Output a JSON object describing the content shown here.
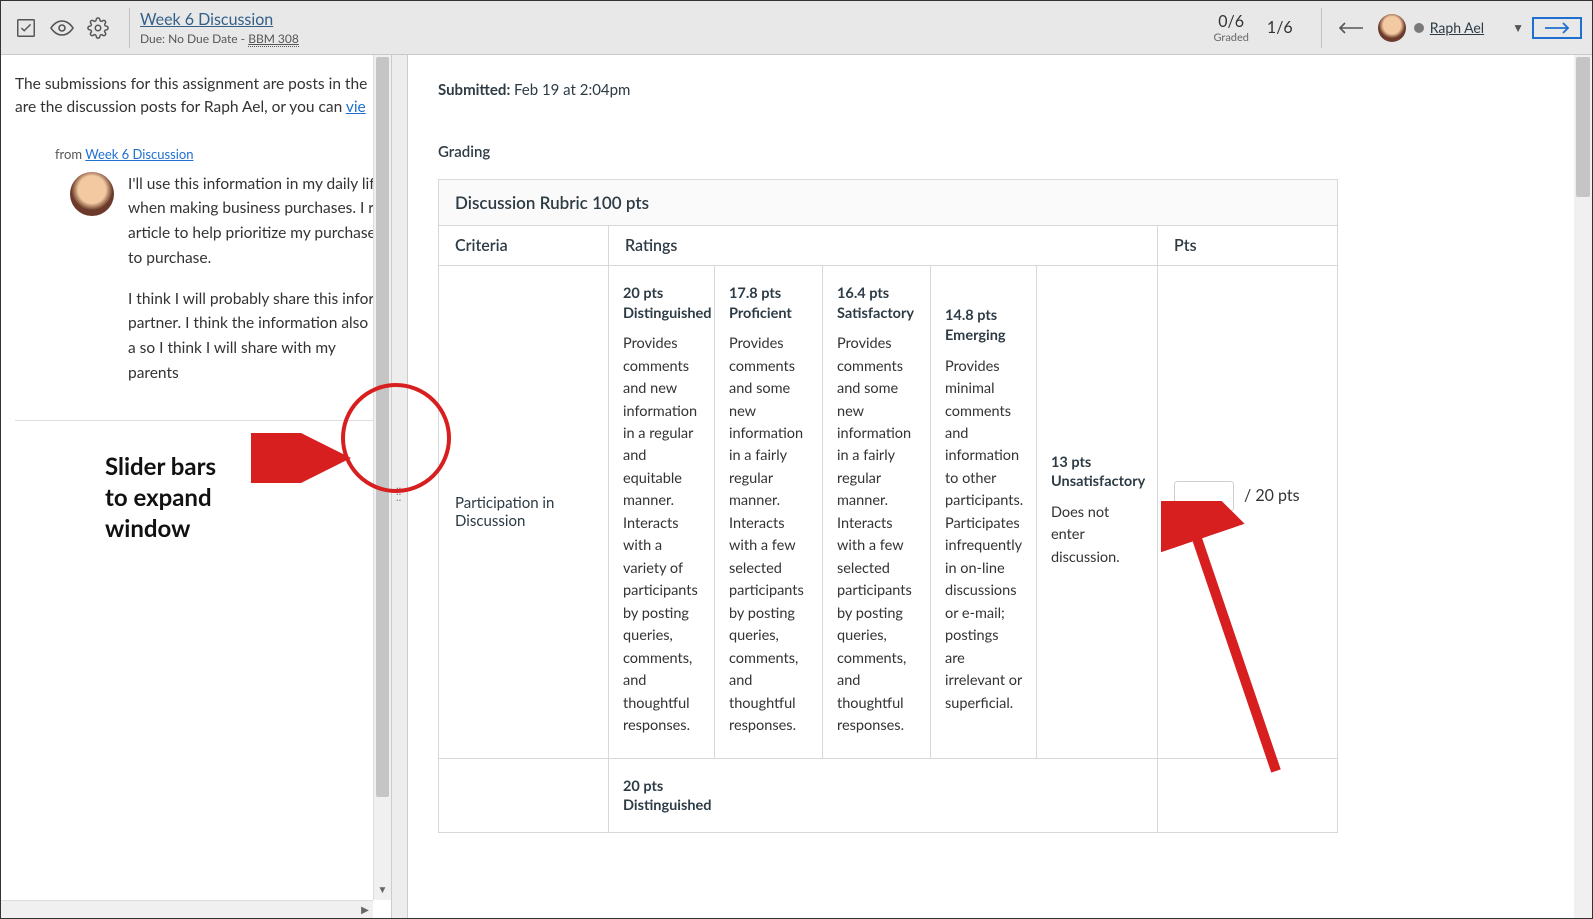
{
  "header": {
    "assignment_title": "Week 6 Discussion",
    "due_prefix": "Due: ",
    "due_text": "No Due Date",
    "due_sep": " - ",
    "course": "BBM 308",
    "graded_count": "0/6",
    "graded_label": "Graded",
    "pager": "1/6",
    "student_name": "Raph Ael"
  },
  "left": {
    "intro_part1": "The submissions for this assignment are posts in the ",
    "intro_part2": "are the discussion posts for Raph Ael, or you can ",
    "intro_link": "vie",
    "from_label": "from ",
    "from_link": "Week 6 Discussion",
    "post_p1": "I'll use this information in my daily lif when making business purchases. I r article to help prioritize my purchase to purchase.",
    "post_p2": "I think I will probably share this infor partner. I think the information also a so I think I will share with my parents"
  },
  "annotation": {
    "line1": "Slider bars",
    "line2": "to expand",
    "line3": "window"
  },
  "right": {
    "submitted_label": "Submitted: ",
    "submitted_value": "Feb 19 at 2:04pm",
    "grading_heading": "Grading",
    "rubric_title": "Discussion Rubric 100 pts",
    "col_criteria": "Criteria",
    "col_ratings": "Ratings",
    "col_pts": "Pts",
    "criterion1": "Participation in Discussion",
    "ratings": [
      {
        "title": "20 pts Distinguished",
        "desc": "Provides comments and new information in a regular and equitable manner. Interacts with a variety of participants by posting queries, comments, and thoughtful responses."
      },
      {
        "title": "17.8 pts Proficient",
        "desc": "Provides comments and some new information in a fairly regular manner. Interacts with a few selected participants by posting queries, comments, and thoughtful responses."
      },
      {
        "title": "16.4 pts Satisfactory",
        "desc": "Provides comments and some new information in a fairly regular manner. Interacts with a few selected participants by posting queries, comments, and thoughtful responses."
      },
      {
        "title": "14.8 pts Emerging",
        "desc": "Provides minimal comments and information to other participants. Participates infrequently in on-line discussions or e-mail; postings are irrelevant or superficial."
      },
      {
        "title": "13 pts Unsatisfactory",
        "desc": "Does not enter discussion."
      }
    ],
    "pts_suffix": "/ 20 pts",
    "row2_rating_title": "20 pts Distinguished"
  }
}
